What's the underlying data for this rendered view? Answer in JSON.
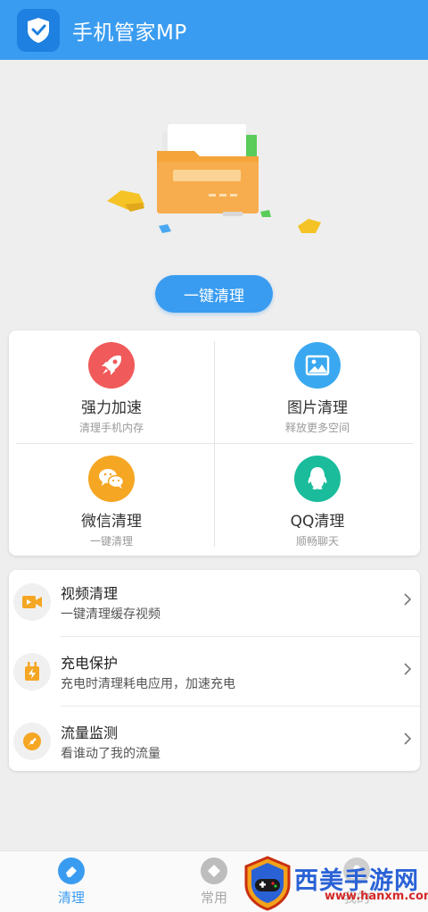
{
  "header": {
    "title": "手机管家MP"
  },
  "hero": {
    "clean_button_label": "一键清理"
  },
  "grid": [
    {
      "title": "强力加速",
      "subtitle": "清理手机内存",
      "color": "#f05a5a",
      "icon": "rocket-icon"
    },
    {
      "title": "图片清理",
      "subtitle": "释放更多空间",
      "color": "#3aa8f0",
      "icon": "image-icon"
    },
    {
      "title": "微信清理",
      "subtitle": "一键清理",
      "color": "#f5a623",
      "icon": "wechat-icon"
    },
    {
      "title": "QQ清理",
      "subtitle": "顺畅聊天",
      "color": "#1abc9c",
      "icon": "qq-icon"
    }
  ],
  "list": [
    {
      "title": "视频清理",
      "subtitle": "一键清理缓存视频",
      "icon": "video-icon"
    },
    {
      "title": "充电保护",
      "subtitle": "充电时清理耗电应用，加速充电",
      "icon": "charging-icon"
    },
    {
      "title": "流量监测",
      "subtitle": "看谁动了我的流量",
      "icon": "gauge-icon"
    }
  ],
  "bottom_nav": [
    {
      "label": "清理",
      "active": true
    },
    {
      "label": "常用",
      "active": false
    },
    {
      "label": "我的",
      "active": false
    }
  ],
  "watermark": {
    "text": "西美手游网",
    "url": "www.hanxm.com"
  },
  "colors": {
    "primary": "#3a9cf0",
    "orange": "#f5a623"
  }
}
